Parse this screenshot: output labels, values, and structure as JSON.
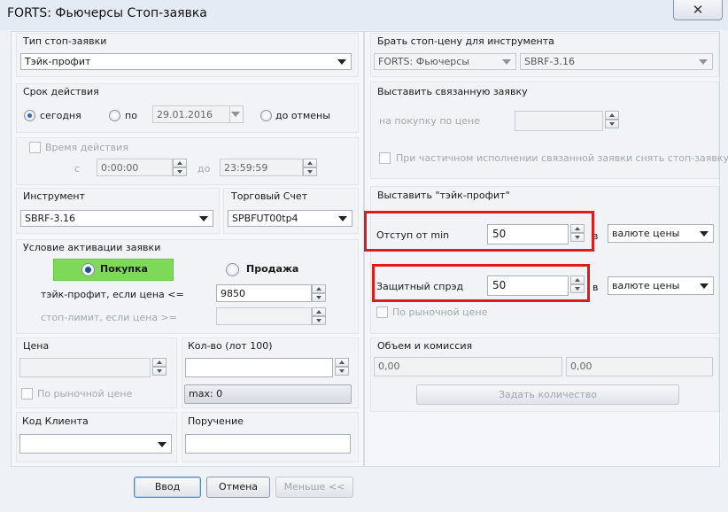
{
  "window": {
    "title": "FORTS: Фьючерсы Стоп-заявка",
    "close_glyph": "✕"
  },
  "order_type": {
    "label": "Тип стоп-заявки",
    "value": "Тэйк-профит"
  },
  "validity": {
    "label": "Срок действия",
    "today": "сегодня",
    "until": "по",
    "date": "29.01.2016",
    "until_cancel": "до отмены"
  },
  "time_range": {
    "label": "Время действия",
    "from_label": "с",
    "from": "0:00:00",
    "to_label": "до",
    "to": "23:59:59"
  },
  "instrument": {
    "label": "Инструмент",
    "value": "SBRF-3.16"
  },
  "account": {
    "label": "Торговый Счет",
    "value": "SPBFUT00tp4"
  },
  "activation": {
    "label": "Условие активации заявки",
    "buy": "Покупка",
    "sell": "Продажа",
    "tp_label": "тэйк-профит, если цена <=",
    "tp_value": "9850",
    "sl_label": "стоп-лимит, если цена >="
  },
  "price": {
    "label": "Цена",
    "market": "По рыночной цене"
  },
  "qty": {
    "label": "Кол-во (лот 100)",
    "max": "max: 0"
  },
  "client": {
    "label": "Код Клиента"
  },
  "comment": {
    "label": "Поручение"
  },
  "stop_price_source": {
    "label": "Брать стоп-цену для инструмента",
    "class_value": "FORTS: Фьючерсы",
    "sec_value": "SBRF-3.16"
  },
  "linked_order": {
    "label": "Выставить связанную заявку",
    "buy_price_label": "на покупку по цене",
    "partial_label": "При частичном исполнении связанной заявки снять стоп-заявку"
  },
  "take_profit": {
    "label": "Выставить \"тэйк-профит\"",
    "offset_label": "Отступ от min",
    "offset_value": "50",
    "offset_unit_prefix": "в",
    "offset_unit": "валюте цены",
    "spread_label": "Защитный спрэд",
    "spread_value": "50",
    "spread_unit_prefix": "в",
    "spread_unit": "валюте цены",
    "market": "По рыночной цене"
  },
  "volume": {
    "label": "Объем и комиссия",
    "v1": "0,00",
    "v2": "0,00",
    "set_qty": "Задать количество"
  },
  "footer": {
    "enter": "Ввод",
    "cancel": "Отмена",
    "less": "Меньше <<"
  },
  "colors": {
    "buy_highlight": "#7ed957",
    "annotation": "#e01b1b",
    "accent": "#2b6bb8"
  }
}
